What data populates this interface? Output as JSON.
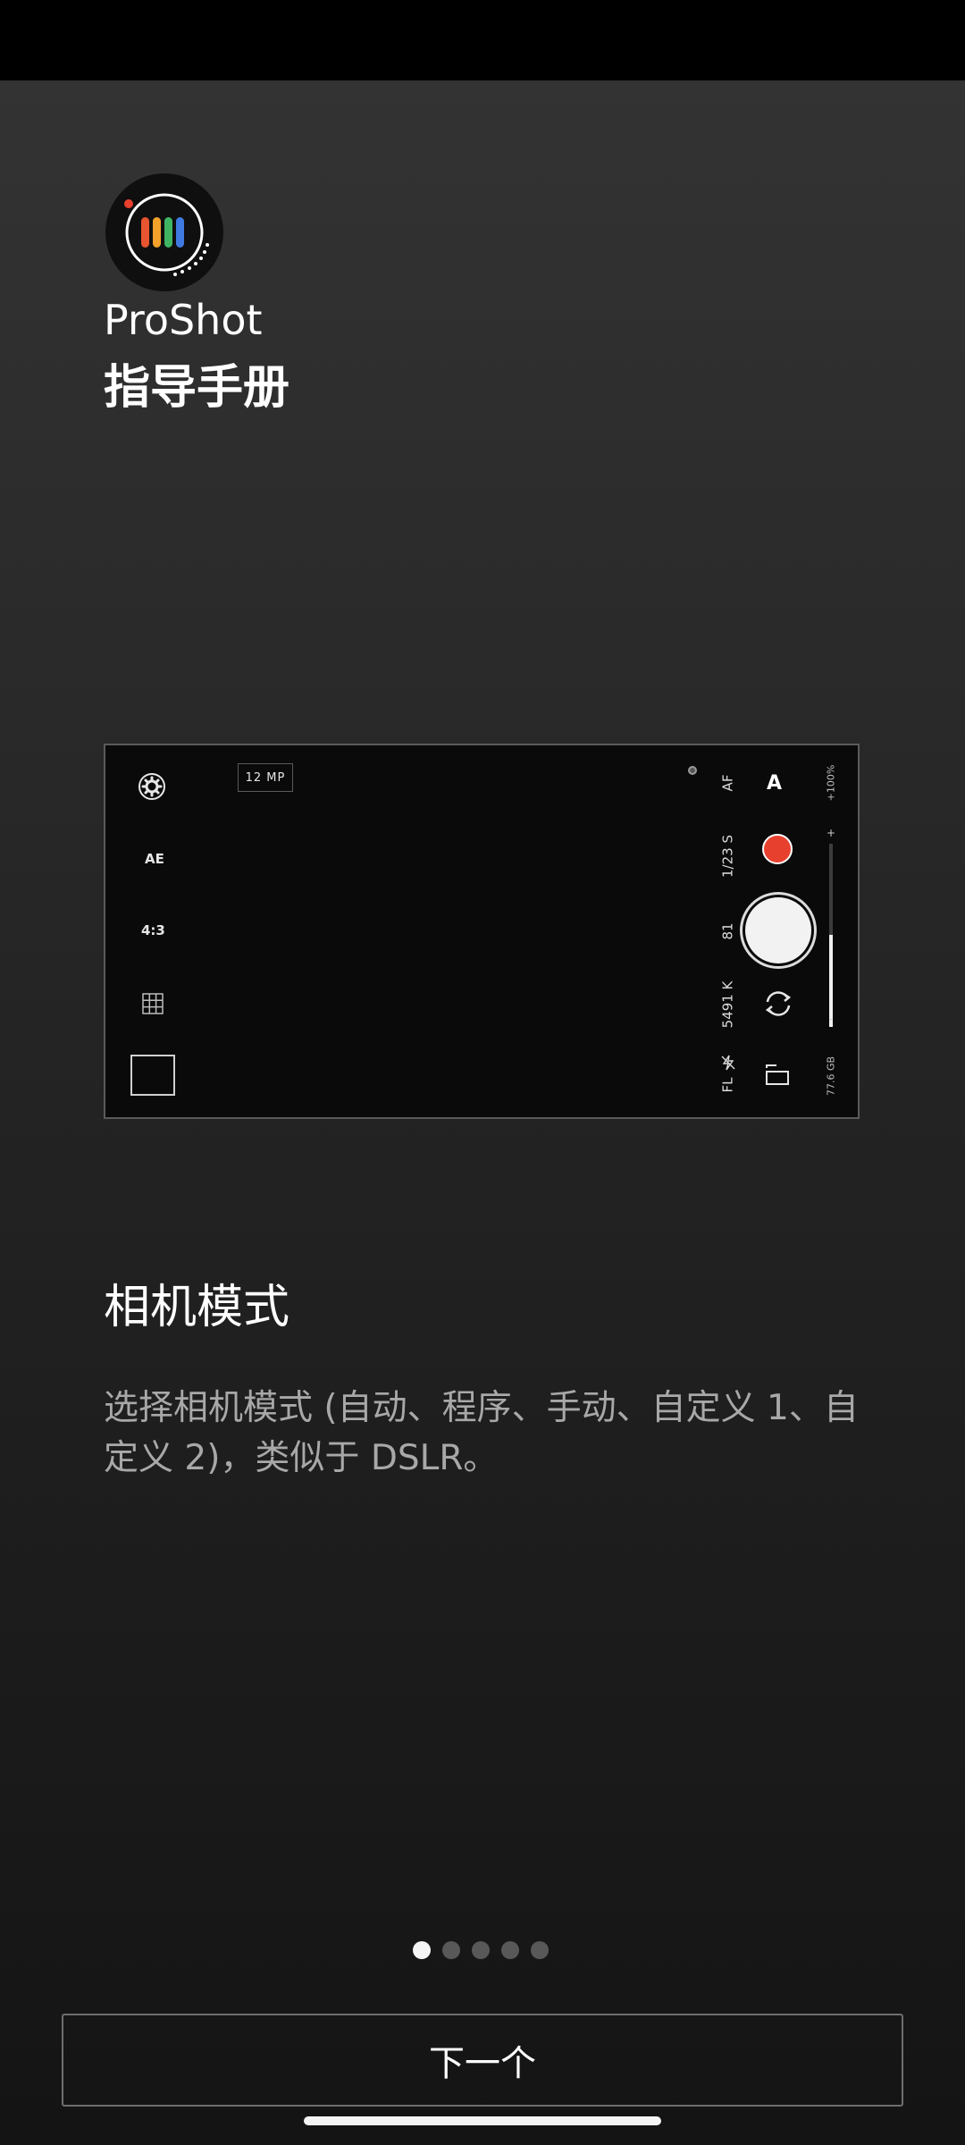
{
  "app": {
    "name": "ProShot",
    "guide_title": "指导手册",
    "logo_colors": [
      "#e8542f",
      "#f2a12a",
      "#3fb463",
      "#3f7ae0"
    ]
  },
  "preview": {
    "resolution_badge": "12 MP",
    "left_controls": {
      "settings_icon": "gear-icon",
      "ae_label": "AE",
      "aspect_ratio": "4:3",
      "grid_icon": "grid-icon"
    },
    "readouts": {
      "af": "AF",
      "shutter_speed": "1/23 S",
      "iso": "81",
      "white_balance": "5491 K",
      "flash": "FL"
    },
    "mode": "A",
    "zoom_percent": "+100%",
    "zoom_plus": "+",
    "zoom_minus": "-",
    "storage": "77.6 GB",
    "zoom_level_fraction": 0.5,
    "record_color": "#e8402f"
  },
  "section": {
    "title": "相机模式",
    "description": "选择相机模式 (自动、程序、手动、自定义 1、自定义 2)，类似于 DSLR。"
  },
  "pagination": {
    "total": 5,
    "active_index": 0
  },
  "next_button": "下一个"
}
